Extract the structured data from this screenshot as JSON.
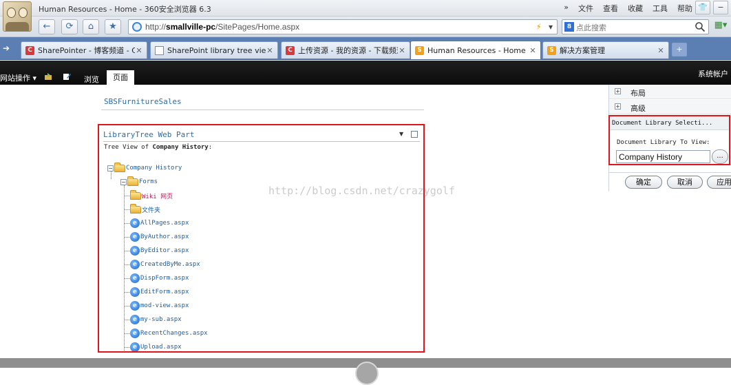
{
  "window": {
    "title": "Human Resources - Home - 360安全浏览器 6.3",
    "menu": [
      "»",
      "文件",
      "查看",
      "收藏",
      "工具",
      "帮助"
    ]
  },
  "address": {
    "url_prefix": "http://",
    "url_host": "smallville-pc",
    "url_path": "/SitePages/Home.aspx",
    "search_placeholder": "点此搜索"
  },
  "tabs": [
    {
      "label": "SharePointer - 博客频道 - CSDI",
      "icon": "csdn-icon",
      "active": false
    },
    {
      "label": "SharePoint library tree view we",
      "icon": "page-icon",
      "active": false
    },
    {
      "label": "上传资源 - 我的资源 - 下载频道",
      "icon": "csdn-icon",
      "active": false
    },
    {
      "label": "Human Resources - Home",
      "icon": "sharepoint-icon",
      "active": true
    },
    {
      "label": "解决方案管理",
      "icon": "sharepoint-icon",
      "active": false
    }
  ],
  "ribbon": {
    "site_actions": "网站操作 ▾",
    "browse": "浏览",
    "page": "页面",
    "user": "系统帐户"
  },
  "content": {
    "site_title": "SBSFurnitureSales",
    "webpart_title": "LibraryTree Web Part",
    "subtitle_prefix": "Tree View of ",
    "subtitle_library": "Company History",
    "subtitle_suffix": ":"
  },
  "tree": {
    "root": "Company History",
    "folder": "Forms",
    "subfolders": [
      "Wiki 网页",
      "文件夹"
    ],
    "files": [
      "AllPages.aspx",
      "ByAuthor.aspx",
      "ByEditor.aspx",
      "CreatedByMe.aspx",
      "DispForm.aspx",
      "EditForm.aspx",
      "mod-view.aspx",
      "my-sub.aspx",
      "RecentChanges.aspx",
      "Upload.aspx"
    ]
  },
  "watermark": "http://blog.csdn.net/crazygolf",
  "toolpane": {
    "sections": [
      "布局",
      "高级"
    ],
    "editor_title": "Document Library Selecti...",
    "field_label": "Document Library To View:",
    "field_value": "Company History",
    "browse_label": "...",
    "ok": "确定",
    "cancel": "取消",
    "apply": "应用"
  }
}
